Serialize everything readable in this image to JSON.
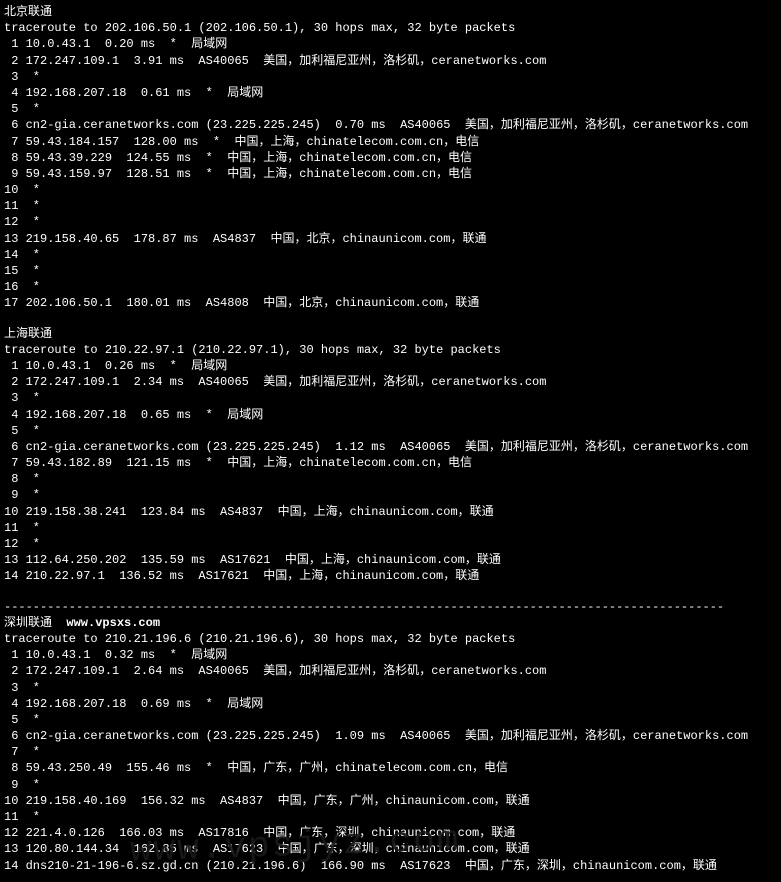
{
  "sections": [
    {
      "name": "beijing-unicom",
      "title": "北京联通",
      "brand": "",
      "traceroute_header": "traceroute to 202.106.50.1 (202.106.50.1), 30 hops max, 32 byte packets",
      "hops": [
        {
          "n": " 1",
          "ip": "10.0.43.1",
          "ms": "0.20 ms",
          "star": "*",
          "asn": "",
          "info": "局域网"
        },
        {
          "n": " 2",
          "ip": "172.247.109.1",
          "ms": "3.91 ms",
          "star": "",
          "asn": "AS40065",
          "info": "美国，加利福尼亚州，洛杉矶，ceranetworks.com"
        },
        {
          "n": " 3",
          "ip": "*",
          "ms": "",
          "star": "",
          "asn": "",
          "info": ""
        },
        {
          "n": " 4",
          "ip": "192.168.207.18",
          "ms": "0.61 ms",
          "star": "*",
          "asn": "",
          "info": "局域网"
        },
        {
          "n": " 5",
          "ip": "*",
          "ms": "",
          "star": "",
          "asn": "",
          "info": ""
        },
        {
          "n": " 6",
          "ip": "cn2-gia.ceranetworks.com (23.225.225.245)",
          "ms": "0.70 ms",
          "star": "",
          "asn": "AS40065",
          "info": "美国，加利福尼亚州，洛杉矶，ceranetworks.com"
        },
        {
          "n": " 7",
          "ip": "59.43.184.157",
          "ms": "128.00 ms",
          "star": "*",
          "asn": "",
          "info": "中国，上海，chinatelecom.com.cn，电信"
        },
        {
          "n": " 8",
          "ip": "59.43.39.229",
          "ms": "124.55 ms",
          "star": "*",
          "asn": "",
          "info": "中国，上海，chinatelecom.com.cn，电信"
        },
        {
          "n": " 9",
          "ip": "59.43.159.97",
          "ms": "128.51 ms",
          "star": "*",
          "asn": "",
          "info": "中国，上海，chinatelecom.com.cn，电信"
        },
        {
          "n": "10",
          "ip": "*",
          "ms": "",
          "star": "",
          "asn": "",
          "info": ""
        },
        {
          "n": "11",
          "ip": "*",
          "ms": "",
          "star": "",
          "asn": "",
          "info": ""
        },
        {
          "n": "12",
          "ip": "*",
          "ms": "",
          "star": "",
          "asn": "",
          "info": ""
        },
        {
          "n": "13",
          "ip": "219.158.40.65",
          "ms": "178.87 ms",
          "star": "",
          "asn": "AS4837",
          "info": "中国，北京，chinaunicom.com，联通"
        },
        {
          "n": "14",
          "ip": "*",
          "ms": "",
          "star": "",
          "asn": "",
          "info": ""
        },
        {
          "n": "15",
          "ip": "*",
          "ms": "",
          "star": "",
          "asn": "",
          "info": ""
        },
        {
          "n": "16",
          "ip": "*",
          "ms": "",
          "star": "",
          "asn": "",
          "info": ""
        },
        {
          "n": "17",
          "ip": "202.106.50.1",
          "ms": "180.01 ms",
          "star": "",
          "asn": "AS4808",
          "info": "中国，北京，chinaunicom.com，联通"
        }
      ]
    },
    {
      "name": "shanghai-unicom",
      "title": "上海联通",
      "brand": "",
      "traceroute_header": "traceroute to 210.22.97.1 (210.22.97.1), 30 hops max, 32 byte packets",
      "hops": [
        {
          "n": " 1",
          "ip": "10.0.43.1",
          "ms": "0.26 ms",
          "star": "*",
          "asn": "",
          "info": "局域网"
        },
        {
          "n": " 2",
          "ip": "172.247.109.1",
          "ms": "2.34 ms",
          "star": "",
          "asn": "AS40065",
          "info": "美国，加利福尼亚州，洛杉矶，ceranetworks.com"
        },
        {
          "n": " 3",
          "ip": "*",
          "ms": "",
          "star": "",
          "asn": "",
          "info": ""
        },
        {
          "n": " 4",
          "ip": "192.168.207.18",
          "ms": "0.65 ms",
          "star": "*",
          "asn": "",
          "info": "局域网"
        },
        {
          "n": " 5",
          "ip": "*",
          "ms": "",
          "star": "",
          "asn": "",
          "info": ""
        },
        {
          "n": " 6",
          "ip": "cn2-gia.ceranetworks.com (23.225.225.245)",
          "ms": "1.12 ms",
          "star": "",
          "asn": "AS40065",
          "info": "美国，加利福尼亚州，洛杉矶，ceranetworks.com"
        },
        {
          "n": " 7",
          "ip": "59.43.182.89",
          "ms": "121.15 ms",
          "star": "*",
          "asn": "",
          "info": "中国，上海，chinatelecom.com.cn，电信"
        },
        {
          "n": " 8",
          "ip": "*",
          "ms": "",
          "star": "",
          "asn": "",
          "info": ""
        },
        {
          "n": " 9",
          "ip": "*",
          "ms": "",
          "star": "",
          "asn": "",
          "info": ""
        },
        {
          "n": "10",
          "ip": "219.158.38.241",
          "ms": "123.84 ms",
          "star": "",
          "asn": "AS4837",
          "info": "中国，上海，chinaunicom.com，联通"
        },
        {
          "n": "11",
          "ip": "*",
          "ms": "",
          "star": "",
          "asn": "",
          "info": ""
        },
        {
          "n": "12",
          "ip": "*",
          "ms": "",
          "star": "",
          "asn": "",
          "info": ""
        },
        {
          "n": "13",
          "ip": "112.64.250.202",
          "ms": "135.59 ms",
          "star": "",
          "asn": "AS17621",
          "info": "中国，上海，chinaunicom.com，联通"
        },
        {
          "n": "14",
          "ip": "210.22.97.1",
          "ms": "136.52 ms",
          "star": "",
          "asn": "AS17621",
          "info": "中国，上海，chinaunicom.com，联通"
        }
      ]
    },
    {
      "name": "shenzhen-unicom",
      "title": "深圳联通",
      "brand": "www.vpsxs.com",
      "traceroute_header": "traceroute to 210.21.196.6 (210.21.196.6), 30 hops max, 32 byte packets",
      "hops": [
        {
          "n": " 1",
          "ip": "10.0.43.1",
          "ms": "0.32 ms",
          "star": "*",
          "asn": "",
          "info": "局域网"
        },
        {
          "n": " 2",
          "ip": "172.247.109.1",
          "ms": "2.64 ms",
          "star": "",
          "asn": "AS40065",
          "info": "美国，加利福尼亚州，洛杉矶，ceranetworks.com"
        },
        {
          "n": " 3",
          "ip": "*",
          "ms": "",
          "star": "",
          "asn": "",
          "info": ""
        },
        {
          "n": " 4",
          "ip": "192.168.207.18",
          "ms": "0.69 ms",
          "star": "*",
          "asn": "",
          "info": "局域网"
        },
        {
          "n": " 5",
          "ip": "*",
          "ms": "",
          "star": "",
          "asn": "",
          "info": ""
        },
        {
          "n": " 6",
          "ip": "cn2-gia.ceranetworks.com (23.225.225.245)",
          "ms": "1.09 ms",
          "star": "",
          "asn": "AS40065",
          "info": "美国，加利福尼亚州，洛杉矶，ceranetworks.com"
        },
        {
          "n": " 7",
          "ip": "*",
          "ms": "",
          "star": "",
          "asn": "",
          "info": ""
        },
        {
          "n": " 8",
          "ip": "59.43.250.49",
          "ms": "155.46 ms",
          "star": "*",
          "asn": "",
          "info": "中国，广东，广州，chinatelecom.com.cn，电信"
        },
        {
          "n": " 9",
          "ip": "*",
          "ms": "",
          "star": "",
          "asn": "",
          "info": ""
        },
        {
          "n": "10",
          "ip": "219.158.40.169",
          "ms": "156.32 ms",
          "star": "",
          "asn": "AS4837",
          "info": "中国，广东，广州，chinaunicom.com，联通"
        },
        {
          "n": "11",
          "ip": "*",
          "ms": "",
          "star": "",
          "asn": "",
          "info": ""
        },
        {
          "n": "12",
          "ip": "221.4.0.126",
          "ms": "166.03 ms",
          "star": "",
          "asn": "AS17816",
          "info": "中国，广东，深圳，chinaunicom.com，联通"
        },
        {
          "n": "13",
          "ip": "120.80.144.34",
          "ms": "162.85 ms",
          "star": "",
          "asn": "AS17623",
          "info": "中国，广东，深圳，chinaunicom.com，联通"
        },
        {
          "n": "14",
          "ip": "dns210-21-196-6.sz.gd.cn (210.21.196.6)",
          "ms": "166.90 ms",
          "star": "",
          "asn": "AS17623",
          "info": "中国，广东，深圳，chinaunicom.com，联通"
        }
      ]
    }
  ],
  "dashed_line": "----------------------------------------------------------------------------------------------------",
  "watermark": "www.vpsjyz.com"
}
